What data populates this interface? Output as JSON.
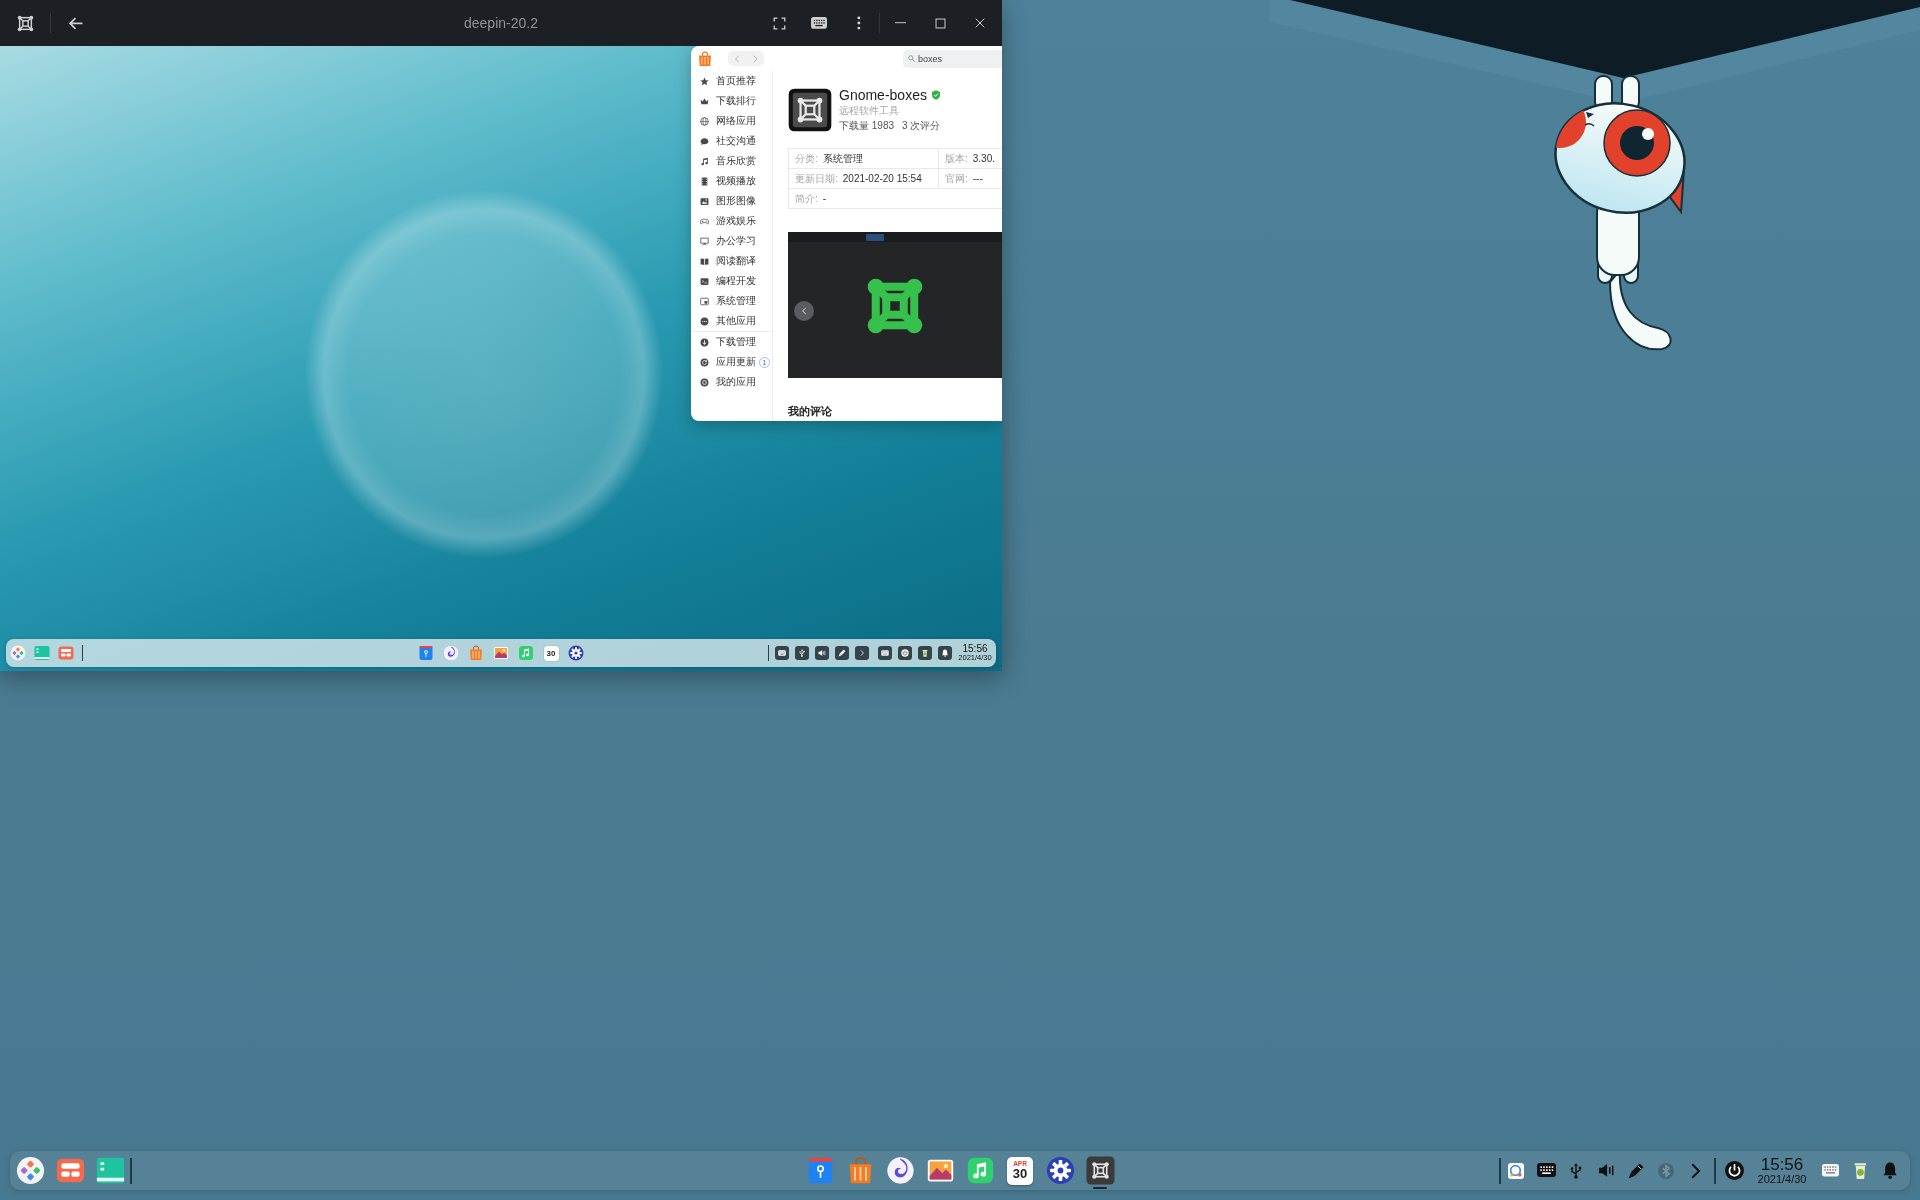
{
  "vm_window": {
    "title": "deepin-20.2"
  },
  "app_store": {
    "search": {
      "value": "boxes"
    },
    "categories": [
      {
        "label": "首页推荐",
        "selected": false
      },
      {
        "label": "下载排行",
        "selected": false
      },
      {
        "label": "网络应用",
        "selected": false
      },
      {
        "label": "社交沟通",
        "selected": false
      },
      {
        "label": "音乐欣赏",
        "selected": false
      },
      {
        "label": "视频播放",
        "selected": false
      },
      {
        "label": "图形图像",
        "selected": false
      },
      {
        "label": "游戏娱乐",
        "selected": false
      },
      {
        "label": "办公学习",
        "selected": false
      },
      {
        "label": "阅读翻译",
        "selected": false
      },
      {
        "label": "编程开发",
        "selected": false
      },
      {
        "label": "系统管理",
        "selected": false
      },
      {
        "label": "其他应用",
        "selected": false
      }
    ],
    "manage": [
      {
        "label": "下载管理",
        "selected": false
      },
      {
        "label": "应用更新",
        "selected": false,
        "badge": "1"
      },
      {
        "label": "我的应用",
        "selected": false
      }
    ],
    "app": {
      "name": "Gnome-boxes",
      "verified": true,
      "subtitle": "远程软件工具",
      "downloads": "下载量 1983",
      "ratings": "3 次评分"
    },
    "details": [
      [
        {
          "label": "分类:",
          "value": "系统管理"
        },
        {
          "label": "版本:",
          "value": "3.30."
        }
      ],
      [
        {
          "label": "更新日期:",
          "value": "2021-02-20 15:54"
        },
        {
          "label": "官网:",
          "value": "---"
        }
      ],
      [
        {
          "label": "简介:",
          "value": "-"
        }
      ]
    ],
    "reviews_heading": "我的评论"
  },
  "guest_taskbar": {
    "calendar_day": "30",
    "clock": {
      "time": "15:56",
      "date": "2021/4/30"
    }
  },
  "dock": {
    "apps": [
      {
        "running": false
      },
      {
        "running": false
      },
      {
        "running": false
      },
      {
        "running": false
      },
      {
        "running": false
      },
      {
        "running": false,
        "month": "APR",
        "day": "30"
      },
      {
        "running": false
      },
      {
        "running": true
      }
    ],
    "tray": [
      {
        "dimmed": false
      },
      {
        "dimmed": false
      },
      {
        "dimmed": false
      },
      {
        "dimmed": false
      },
      {
        "dimmed": false
      },
      {
        "dimmed": true
      },
      {
        "dimmed": false
      }
    ],
    "clock": {
      "time": "15:56",
      "date": "2021/4/30"
    }
  }
}
